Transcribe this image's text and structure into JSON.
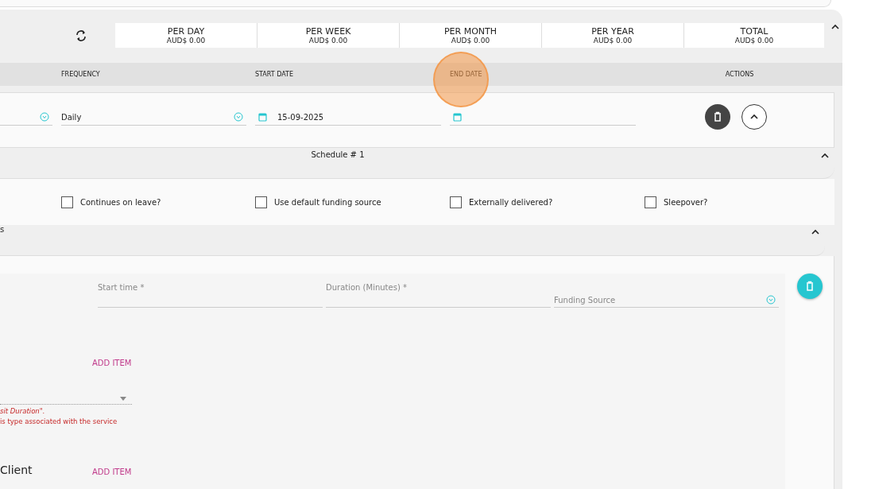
{
  "summary": {
    "totals": [
      {
        "label": "PER DAY",
        "value": "AUD$ 0.00"
      },
      {
        "label": "PER WEEK",
        "value": "AUD$ 0.00"
      },
      {
        "label": "PER MONTH",
        "value": "AUD$ 0.00"
      },
      {
        "label": "PER YEAR",
        "value": "AUD$ 0.00"
      },
      {
        "label": "TOTAL",
        "value": "AUD$ 0.00"
      }
    ]
  },
  "table": {
    "columns": [
      {
        "label": "FREQUENCY"
      },
      {
        "label": "START DATE"
      },
      {
        "label": "END DATE"
      },
      {
        "label": "ACTIONS"
      }
    ],
    "row": {
      "frequency": "Daily",
      "start_date": "15-09-2025"
    }
  },
  "schedule": {
    "title": "Schedule # 1"
  },
  "options": [
    {
      "label": "Continues on leave?",
      "checked": false
    },
    {
      "label": "Use default funding source",
      "checked": false
    },
    {
      "label": "Externally delivered?",
      "checked": false
    },
    {
      "label": "Sleepover?",
      "checked": false
    }
  ],
  "section_2": {
    "title": "s"
  },
  "visit": {
    "fields": [
      {
        "kind": "text",
        "placeholder": "Start time *"
      },
      {
        "kind": "text",
        "placeholder": "Duration (Minutes) *"
      },
      {
        "kind": "select",
        "placeholder": "Funding Source"
      }
    ],
    "add_item": "ADD ITEM",
    "errors": [
      {
        "kind": "emphasis",
        "text": "sit Duration\"."
      },
      {
        "kind": "plain",
        "text": "is type associated with the service"
      }
    ]
  },
  "client": {
    "label": "Client",
    "add_item": "ADD ITEM"
  }
}
